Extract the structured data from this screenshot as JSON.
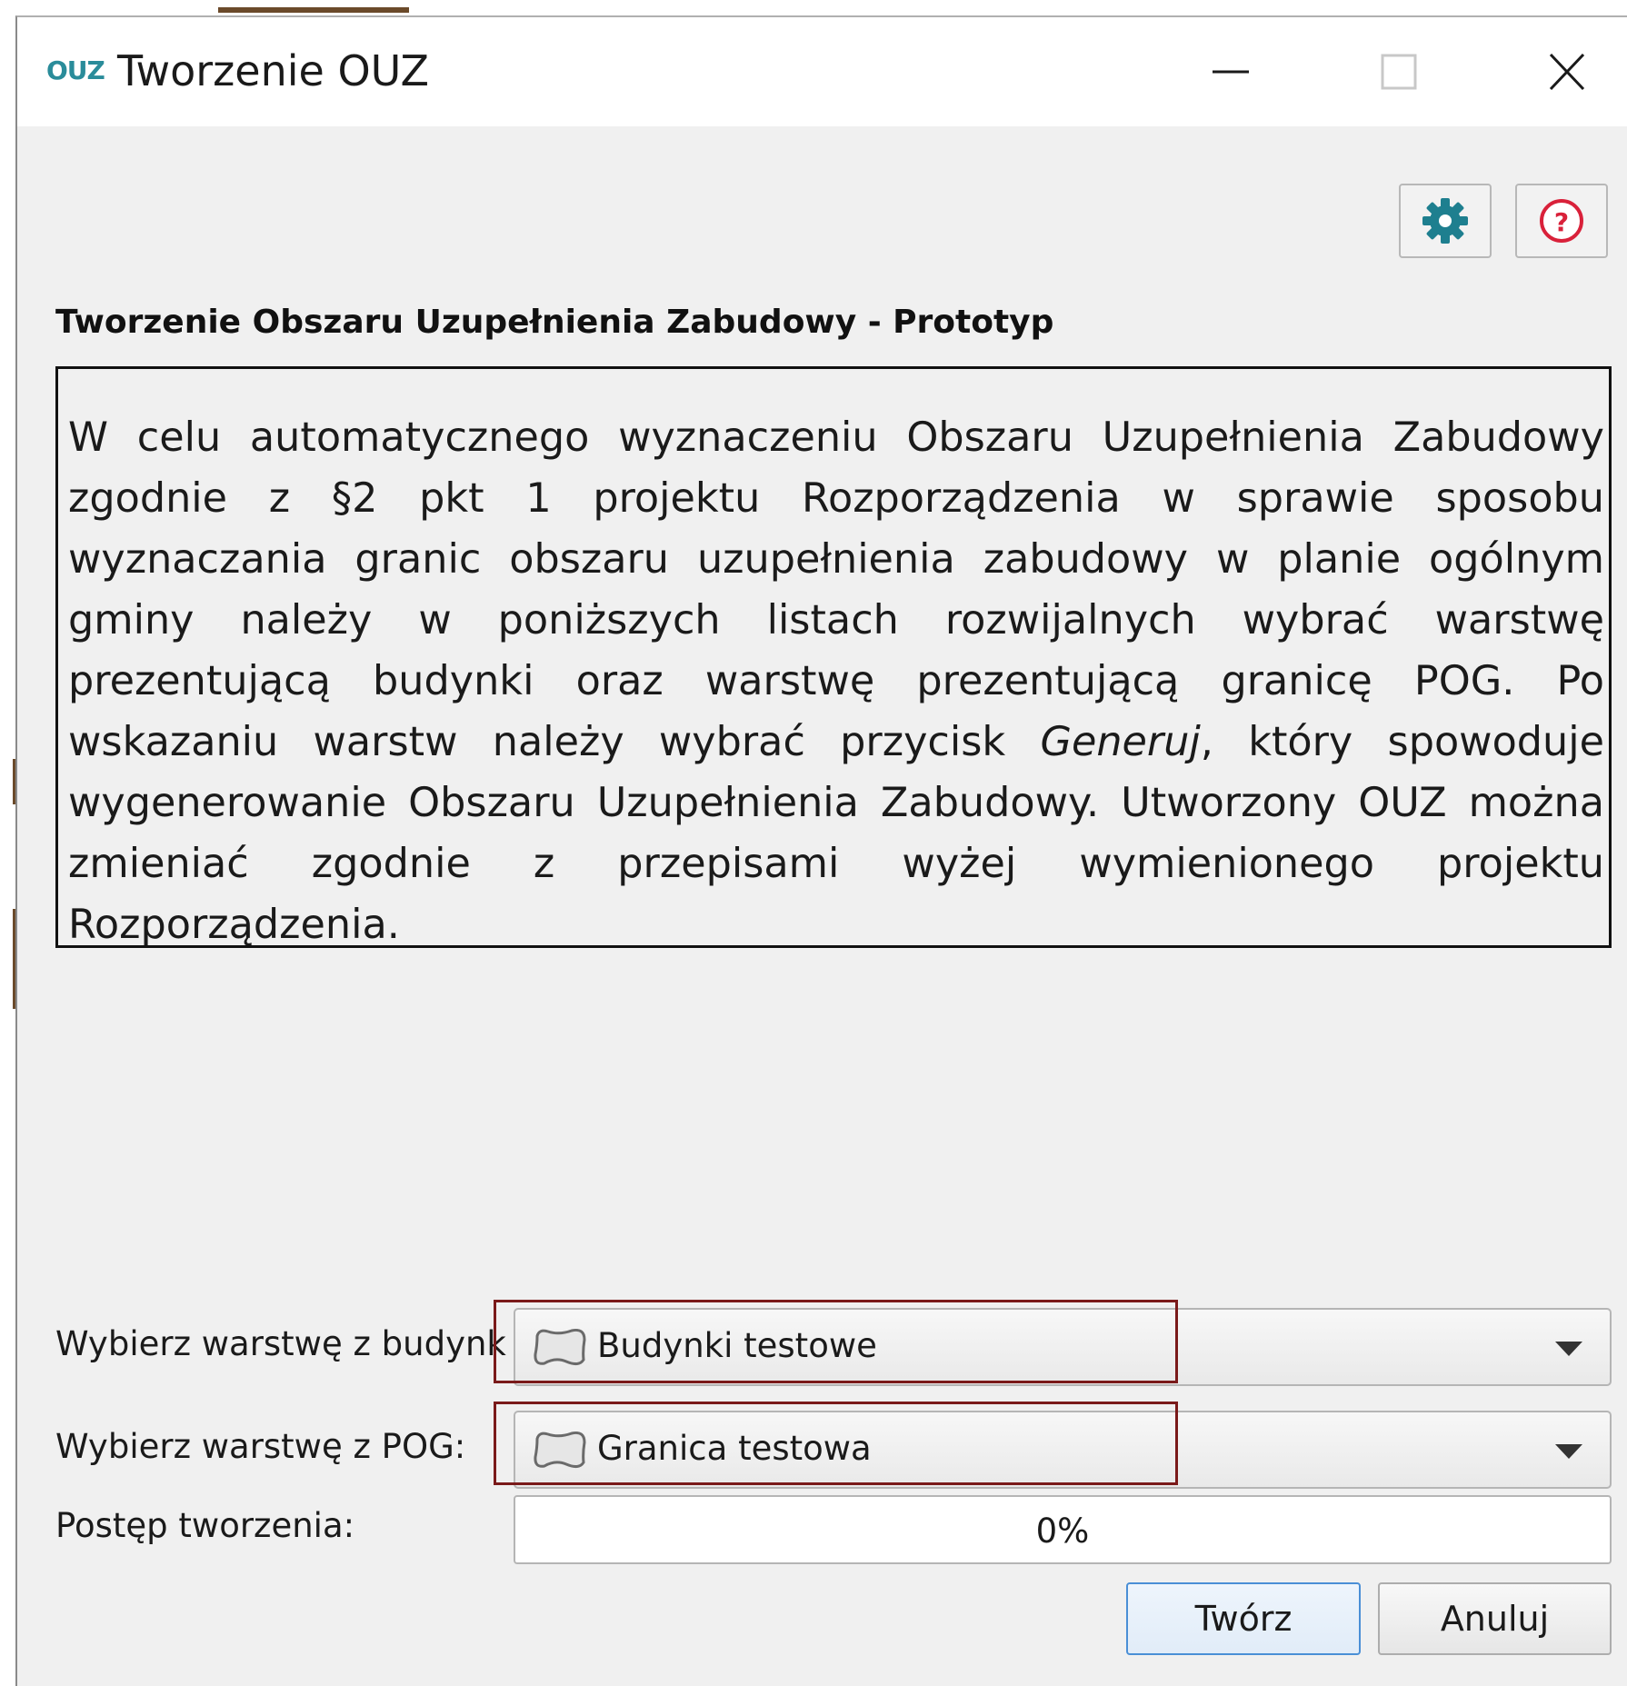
{
  "window": {
    "app_icon_text": "OUZ",
    "title": "Tworzenie OUZ",
    "controls": [
      "minimize-icon",
      "maximize-icon",
      "close-icon"
    ]
  },
  "toolbar": {
    "settings_icon": "gear-icon",
    "help_icon": "question-circle-icon",
    "accent_color": "#1e7f8f",
    "help_color": "#d9213a"
  },
  "heading": "Tworzenie Obszaru Uzupełnienia Zabudowy - Prototyp",
  "description": {
    "before_emphasis": "W celu automatycznego wyznaczeniu Obszaru Uzupełnienia Zabudowy zgodnie z §2 pkt 1 projektu Rozporządzenia w sprawie sposobu wyznaczania granic obszaru uzupełnienia zabudowy w planie ogólnym gminy należy w poniższych listach rozwijalnych wybrać warstwę prezentującą budynki oraz warstwę prezentującą granicę POG. Po wskazaniu warstw należy wybrać przycisk ",
    "emphasis": "Generuj",
    "after_emphasis": ", który spowoduje wygenerowanie Obszaru Uzupełnienia Zabudowy. Utworzony OUZ można zmieniać zgodnie z przepisami wyżej wymienionego projektu Rozporządzenia."
  },
  "form": {
    "buildings_label": "Wybierz warstwę z budynk",
    "buildings_value": "Budynki testowe",
    "pog_label": "Wybierz warstwę z POG:",
    "pog_value": "Granica testowa",
    "layer_icon": "polygon-layer-icon",
    "progress_label": "Postęp tworzenia:",
    "progress_text": "0%",
    "progress_value": 0
  },
  "buttons": {
    "create": "Twórz",
    "cancel": "Anuluj"
  },
  "highlight_color": "#7a1a1a"
}
